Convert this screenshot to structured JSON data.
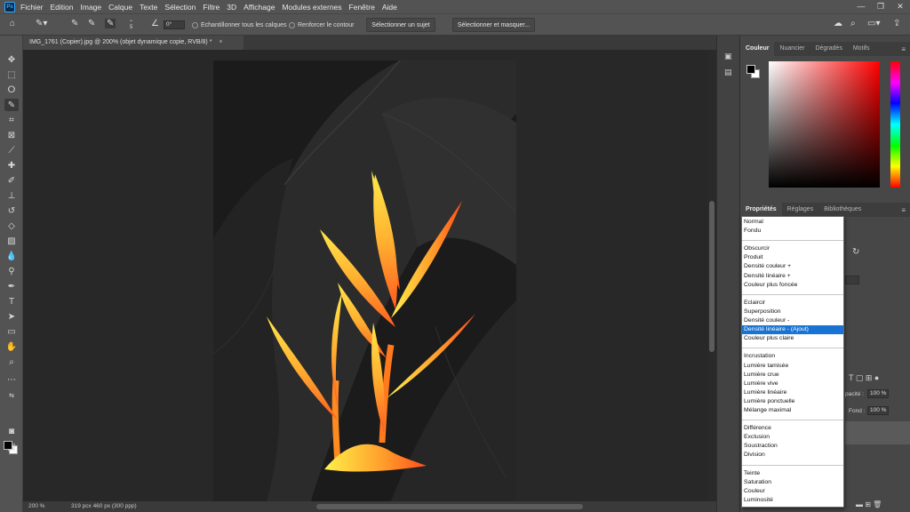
{
  "menu": {
    "logo": "Ps",
    "items": [
      "Fichier",
      "Edition",
      "Image",
      "Calque",
      "Texte",
      "Sélection",
      "Filtre",
      "3D",
      "Affichage",
      "Modules externes",
      "Fenêtre",
      "Aide"
    ],
    "window_controls": [
      "—",
      "❐",
      "✕"
    ]
  },
  "options": {
    "brush_size": "5",
    "angle": "0°",
    "sample_all_layers": "Echantillonner tous les calques",
    "enhance_edge": "Renforcer le contour",
    "select_subject": "Sélectionner un sujet",
    "select_and_mask": "Sélectionner et masquer..."
  },
  "document": {
    "tab_title": "IMG_1761 (Copier).jpg @ 200% (objet dynamique copie, RVB/8) *",
    "close": "×"
  },
  "status": {
    "zoom": "200 %",
    "doc_size": "319 pcx 460 px (300 ppp)"
  },
  "color_panel": {
    "tabs": [
      "Couleur",
      "Nuancier",
      "Dégradés",
      "Motifs"
    ],
    "foreground": "#000000",
    "background": "#ffffff"
  },
  "properties_panel": {
    "tabs": [
      "Propriétés",
      "Réglages",
      "Bibliothèques"
    ]
  },
  "layers_hint": {
    "opacity_label": "pacité :",
    "opacity_value": "100 %",
    "fill_label": "Fond :",
    "fill_value": "100 %"
  },
  "blend_modes": {
    "items": [
      "Normal",
      "Fondu",
      "-",
      "Obscurcir",
      "Produit",
      "Densité couleur +",
      "Densité linéaire +",
      "Couleur plus foncée",
      "-",
      "Eclaircir",
      "Superposition",
      "Densité couleur -",
      "Densité linéaire - (Ajout)",
      "Couleur plus claire",
      "-",
      "Incrustation",
      "Lumière tamisée",
      "Lumière crue",
      "Lumière vive",
      "Lumière linéaire",
      "Lumière ponctuelle",
      "Mélange maximal",
      "-",
      "Différence",
      "Exclusion",
      "Soustraction",
      "Division",
      "-",
      "Teinte",
      "Saturation",
      "Couleur",
      "Luminosité"
    ],
    "selected": "Densité linéaire - (Ajout)"
  },
  "colors": {
    "chrome": "#535353",
    "panel": "#474747",
    "canvas": "#282828",
    "selection": "#1873d3"
  }
}
